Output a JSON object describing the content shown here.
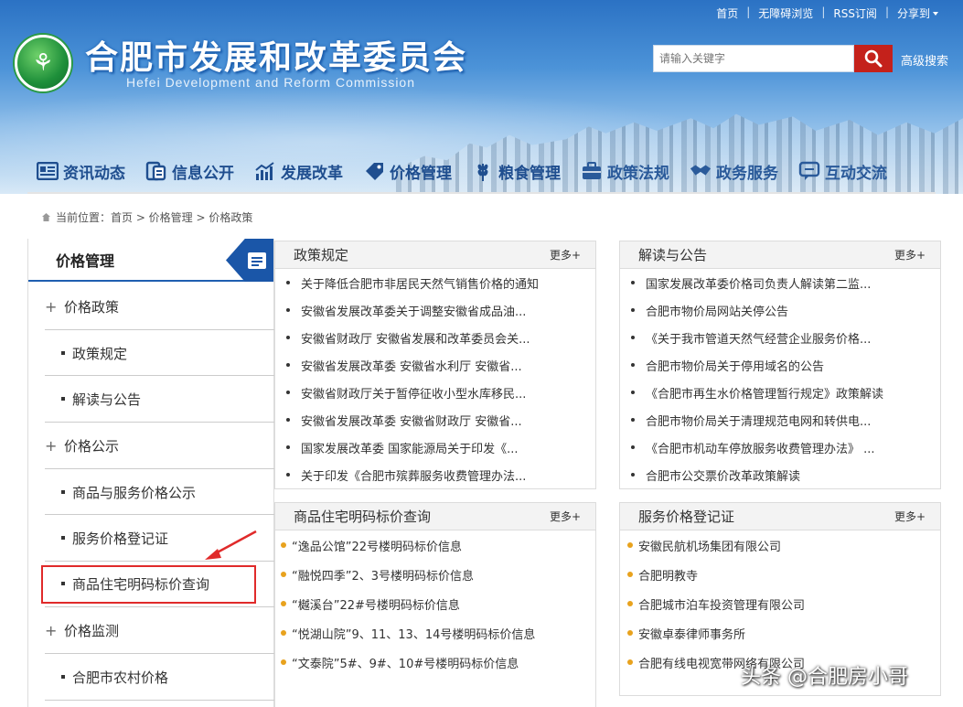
{
  "header": {
    "title": "合肥市发展和改革委员会",
    "subtitle": "Hefei Development and Reform Commission",
    "top_links": [
      "首页",
      "无障碍浏览",
      "RSS订阅",
      "分享到"
    ],
    "search_placeholder": "请输入关键字",
    "advanced_search": "高级搜索",
    "nav": [
      {
        "label": "资讯动态",
        "icon": "news-icon"
      },
      {
        "label": "信息公开",
        "icon": "document-icon"
      },
      {
        "label": "发展改革",
        "icon": "bar-chart-icon"
      },
      {
        "label": "价格管理",
        "icon": "price-tag-icon"
      },
      {
        "label": "粮食管理",
        "icon": "wheat-icon"
      },
      {
        "label": "政策法规",
        "icon": "briefcase-icon"
      },
      {
        "label": "政务服务",
        "icon": "handshake-icon"
      },
      {
        "label": "互动交流",
        "icon": "chat-icon"
      }
    ]
  },
  "breadcrumb": {
    "text": "当前位置：首页 > 价格管理 > 价格政策"
  },
  "sidebar": {
    "title": "价格管理",
    "items": [
      {
        "label": "价格政策",
        "kind": "category"
      },
      {
        "label": "政策规定",
        "kind": "sub"
      },
      {
        "label": "解读与公告",
        "kind": "sub"
      },
      {
        "label": "价格公示",
        "kind": "category"
      },
      {
        "label": "商品与服务价格公示",
        "kind": "sub"
      },
      {
        "label": "服务价格登记证",
        "kind": "sub"
      },
      {
        "label": "商品住宅明码标价查询",
        "kind": "sub"
      },
      {
        "label": "价格监测",
        "kind": "category"
      },
      {
        "label": "合肥市农村价格",
        "kind": "sub"
      }
    ]
  },
  "panels": {
    "policy": {
      "title": "政策规定",
      "more": "更多+",
      "items": [
        "关于降低合肥市非居民天然气销售价格的通知",
        "安徽省发展改革委关于调整安徽省成品油...",
        "安徽省财政厅 安徽省发展和改革委员会关...",
        "安徽省发展改革委 安徽省水利厅 安徽省...",
        "安徽省财政厅关于暂停征收小型水库移民...",
        "安徽省发展改革委 安徽省财政厅 安徽省...",
        "国家发展改革委 国家能源局关于印发《...",
        "关于印发《合肥市殡葬服务收费管理办法..."
      ]
    },
    "interpret": {
      "title": "解读与公告",
      "more": "更多+",
      "items": [
        "国家发展改革委价格司负责人解读第二监...",
        "合肥市物价局网站关停公告",
        "《关于我市管道天然气经营企业服务价格...",
        "合肥市物价局关于停用域名的公告",
        "《合肥市再生水价格管理暂行规定》政策解读",
        "合肥市物价局关于清理规范电网和转供电...",
        "《合肥市机动车停放服务收费管理办法》 ...",
        "合肥市公交票价改革政策解读"
      ]
    },
    "housing": {
      "title": "商品住宅明码标价查询",
      "more": "更多+",
      "items": [
        "“逸品公馆”22号楼明码标价信息",
        "“融悦四季”2、3号楼明码标价信息",
        "“樾溪台”22#号楼明码标价信息",
        "“悦湖山院”9、11、13、14号楼明码标价信息",
        "“文泰院”5#、9#、10#号楼明码标价信息"
      ]
    },
    "service": {
      "title": "服务价格登记证",
      "more": "更多+",
      "items": [
        "安徽民航机场集团有限公司",
        "合肥明教寺",
        "合肥城市泊车投资管理有限公司",
        "安徽卓泰律师事务所",
        "合肥有线电视宽带网络有限公司"
      ]
    }
  },
  "watermark": "头条 @合肥房小哥",
  "colors": {
    "nav_text": "#1f4e8f",
    "search_button": "#c4211b",
    "sidebar_flag": "#1a56a8",
    "highlight": "#e02a2a",
    "bullet_orange": "#e8a21d"
  }
}
